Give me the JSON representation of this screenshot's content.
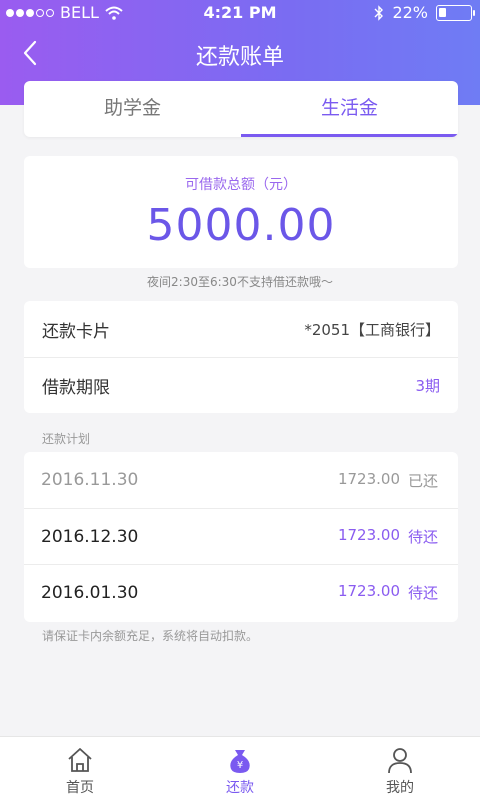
{
  "status_bar": {
    "carrier": "BELL",
    "time": "4:21 PM",
    "battery": "22%",
    "battery_level": 0.22,
    "signal_icon": "signal-dots-icon",
    "wifi_icon": "wifi-icon",
    "bluetooth_icon": "bluetooth-icon"
  },
  "nav": {
    "title": "还款账单",
    "back_icon": "back-arrow-icon"
  },
  "tabs": [
    {
      "label": "助学金",
      "active": false
    },
    {
      "label": "生活金",
      "active": true
    }
  ],
  "amount": {
    "label": "可借款总额（元）",
    "value": "5000.00"
  },
  "notice": "夜间2:30至6:30不支持借还款哦～",
  "info": {
    "card_label": "还款卡片",
    "card_value": "*2051【工商银行】",
    "period_label": "借款期限",
    "period_value": "3期"
  },
  "plan": {
    "label": "还款计划",
    "rows": [
      {
        "date": "2016.11.30",
        "amount": "1723.00",
        "status": "已还",
        "paid": true
      },
      {
        "date": "2016.12.30",
        "amount": "1723.00",
        "status": "待还",
        "paid": false
      },
      {
        "date": "2016.01.30",
        "amount": "1723.00",
        "status": "待还",
        "paid": false
      }
    ]
  },
  "footnote": "请保证卡内余额充足，系统将自动扣款。",
  "tabbar": [
    {
      "label": "首页",
      "icon": "home-icon",
      "active": false
    },
    {
      "label": "还款",
      "icon": "money-bag-icon",
      "active": true
    },
    {
      "label": "我的",
      "icon": "profile-icon",
      "active": false
    }
  ],
  "colors": {
    "accent": "#7a5af0",
    "header_gradient_start": "#9a5cf0",
    "header_gradient_end": "#6f7cf4",
    "background": "#f4f4f6"
  }
}
